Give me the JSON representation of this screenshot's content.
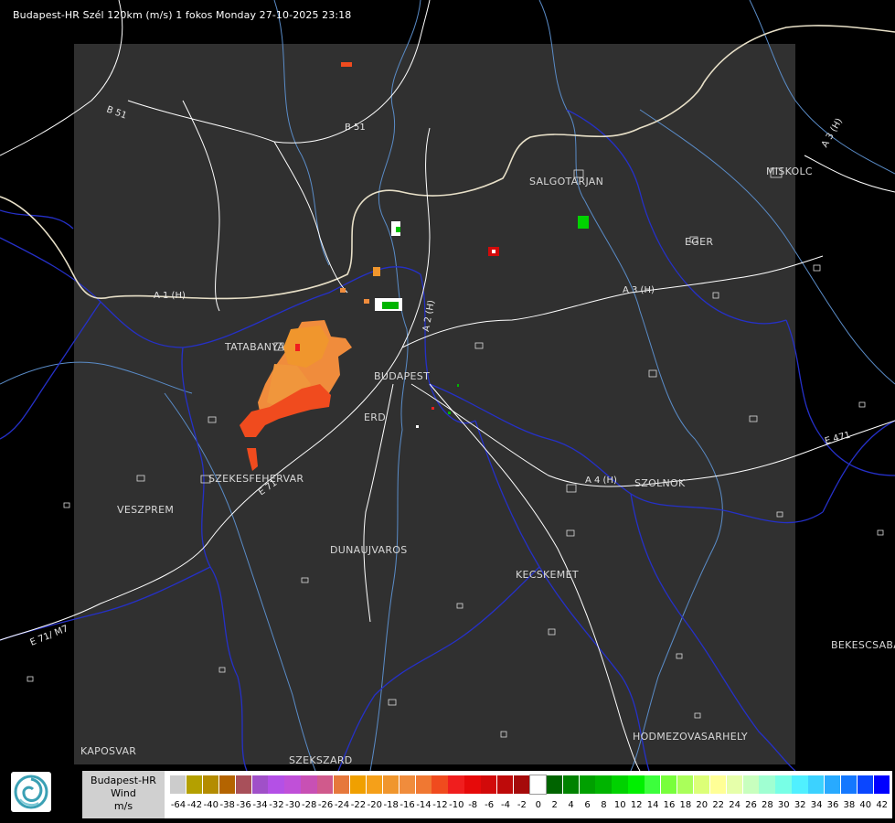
{
  "header": {
    "title": "Budapest-HR Szél 120km (m/s) 1 fokos Monday 27-10-2025 23:18"
  },
  "places": {
    "salgotarjan": "SALGOTARJAN",
    "miskolc": "MISKOLC",
    "eger": "EGER",
    "tatabanya": "TATABANYA",
    "budapest": "BUDAPEST",
    "erd": "ERD",
    "szekesfehervar": "SZEKESFEHERVAR",
    "veszprem": "VESZPREM",
    "szolnok": "SZOLNOK",
    "dunaujvaros": "DUNAUJVAROS",
    "kecskemet": "KECSKEMET",
    "bekescsaba": "BEKESCSABA",
    "hodmezovasarhely": "HODMEZOVASARHELY",
    "kaposvar": "KAPOSVAR",
    "szekszard": "SZEKSZARD"
  },
  "roads": {
    "b51_west": "B 51",
    "b51_east": "B 51",
    "a3_north": "A 3 (H)",
    "a3": "A 3 (H)",
    "a2": "A 2 (H)",
    "a1": "A 1 (H)",
    "a4": "A 4 (H)",
    "e71": "E 71",
    "e71_sw": "E 71/ M7",
    "e471": "E 471"
  },
  "legend": {
    "line1": "Budapest-HR",
    "line2": "Wind",
    "line3": "m/s",
    "labels": [
      "-64",
      "-42",
      "-40",
      "-38",
      "-36",
      "-34",
      "-32",
      "-30",
      "-28",
      "-26",
      "-24",
      "-22",
      "-20",
      "-18",
      "-16",
      "-14",
      "-12",
      "-10",
      "-8",
      "-6",
      "-4",
      "-2",
      "0",
      "2",
      "4",
      "6",
      "8",
      "10",
      "12",
      "14",
      "16",
      "18",
      "20",
      "22",
      "24",
      "26",
      "28",
      "30",
      "32",
      "34",
      "36",
      "38",
      "40",
      "42"
    ],
    "colors": [
      "#cccccc",
      "#b4a000",
      "#b48c00",
      "#b46400",
      "#a8505a",
      "#a050c8",
      "#b450e6",
      "#c050d8",
      "#c850b4",
      "#d05a8c",
      "#e6783c",
      "#f0a000",
      "#f5a019",
      "#f0962d",
      "#f08c3c",
      "#f07832",
      "#f04b1e",
      "#f01e1e",
      "#e60a0a",
      "#d20a0a",
      "#be0a0a",
      "#a50a0a",
      "#ffffff",
      "#006400",
      "#008200",
      "#00a000",
      "#00b400",
      "#00d200",
      "#00f000",
      "#3cff3c",
      "#78ff3c",
      "#aaff5a",
      "#dcff78",
      "#ffff96",
      "#e6ffaa",
      "#c8ffbe",
      "#a0ffd2",
      "#78ffe6",
      "#50f0ff",
      "#3cd2ff",
      "#28aaff",
      "#1478ff",
      "#0a46ff",
      "#0000ff"
    ]
  }
}
